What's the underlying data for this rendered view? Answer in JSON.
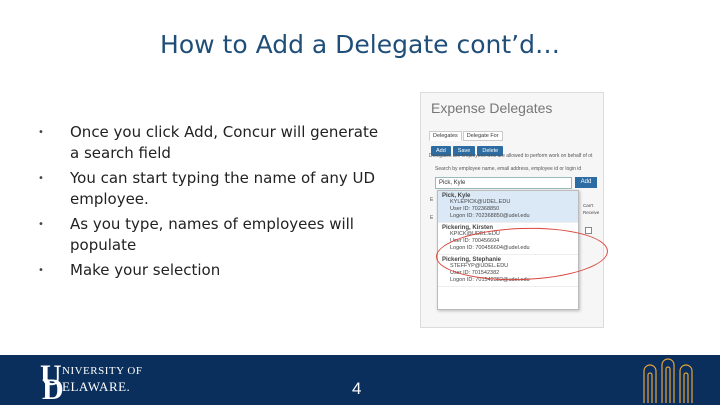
{
  "slide": {
    "title": "How to Add a Delegate cont’d…",
    "page_number": "4",
    "bullets": [
      "Once you click Add, Concur will generate a search field",
      "You can start typing the name of any UD employee.",
      "As you type, names of employees will populate",
      "Make your selection"
    ],
    "bullet_glyph": "•"
  },
  "screenshot": {
    "title": "Expense Delegates",
    "tabs": [
      "Delegates",
      "Delegate For"
    ],
    "buttons": [
      "Add",
      "Save",
      "Delete"
    ],
    "hint": "Delegates are employees who are allowed to perform work on behalf of ot",
    "search_hint": "Search by employee name, email address, employee id or login id",
    "search_value": "Pick, Kyle",
    "add_label": "Add",
    "side_letter": "E",
    "results": [
      {
        "name": "Pick, Kyle",
        "email": "KYLEPICK@UDEL.EDU",
        "user_id": "User ID: 702368850",
        "logon": "Logon ID: 702368850@udel.edu"
      },
      {
        "name": "Pickering, Kirsten",
        "email": "KPICK@UDEL.EDU",
        "user_id": "User ID: 700456604",
        "logon": "Logon ID: 700456604@udel.edu"
      },
      {
        "name": "Pickering, Stephanie",
        "email": "STEFFYP@UDEL.EDU",
        "user_id": "User ID: 701542382",
        "logon": "Logon ID: 701542382@udel.edu"
      }
    ],
    "side_column": [
      "Can't",
      "Receive"
    ]
  },
  "footer": {
    "logo_big": "U",
    "logo_line1": "NIVERSITY OF",
    "logo_big2": "D",
    "logo_line2": "ELAWARE."
  },
  "colors": {
    "title": "#1f4e79",
    "footer_bg": "#0a2f5c",
    "circle": "#d9453c",
    "button": "#2d6ca2"
  }
}
